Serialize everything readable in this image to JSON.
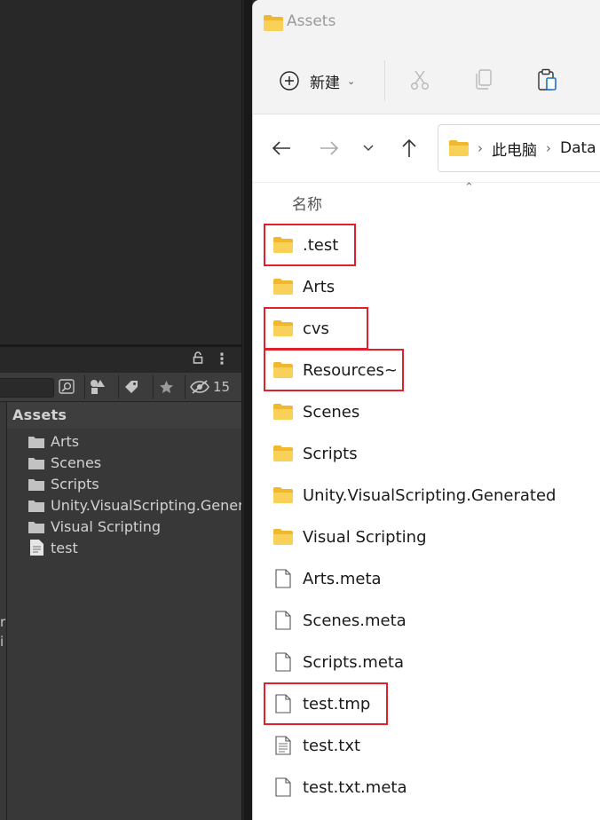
{
  "unity": {
    "hidden_count": "15",
    "header_title": "Assets",
    "clipped_left_chars": [
      "r",
      "i"
    ],
    "tree": [
      {
        "label": "Arts",
        "icon": "folder-icon"
      },
      {
        "label": "Scenes",
        "icon": "folder-icon"
      },
      {
        "label": "Scripts",
        "icon": "folder-icon"
      },
      {
        "label": "Unity.VisualScripting.Generated",
        "icon": "folder-icon"
      },
      {
        "label": "Visual Scripting",
        "icon": "folder-icon"
      },
      {
        "label": "test",
        "icon": "text-file-icon"
      }
    ]
  },
  "explorer": {
    "window_title": "Assets",
    "toolbar": {
      "new_label": "新建"
    },
    "breadcrumb": [
      "此电脑",
      "Data"
    ],
    "column_name": "名称",
    "files": [
      {
        "name": ".test",
        "type": "folder",
        "highlighted": true
      },
      {
        "name": "Arts",
        "type": "folder",
        "highlighted": false
      },
      {
        "name": "cvs",
        "type": "folder",
        "highlighted": true
      },
      {
        "name": "Resources~",
        "type": "folder",
        "highlighted": true
      },
      {
        "name": "Scenes",
        "type": "folder",
        "highlighted": false
      },
      {
        "name": "Scripts",
        "type": "folder",
        "highlighted": false
      },
      {
        "name": "Unity.VisualScripting.Generated",
        "type": "folder",
        "highlighted": false
      },
      {
        "name": "Visual Scripting",
        "type": "folder",
        "highlighted": false
      },
      {
        "name": "Arts.meta",
        "type": "file",
        "highlighted": false
      },
      {
        "name": "Scenes.meta",
        "type": "file",
        "highlighted": false
      },
      {
        "name": "Scripts.meta",
        "type": "file",
        "highlighted": false
      },
      {
        "name": "test.tmp",
        "type": "file",
        "highlighted": true
      },
      {
        "name": "test.txt",
        "type": "text",
        "highlighted": false
      },
      {
        "name": "test.txt.meta",
        "type": "file",
        "highlighted": false
      }
    ]
  },
  "colors": {
    "highlight": "#e0202c",
    "folder": "#f5c443",
    "unity_bg": "#383838"
  }
}
